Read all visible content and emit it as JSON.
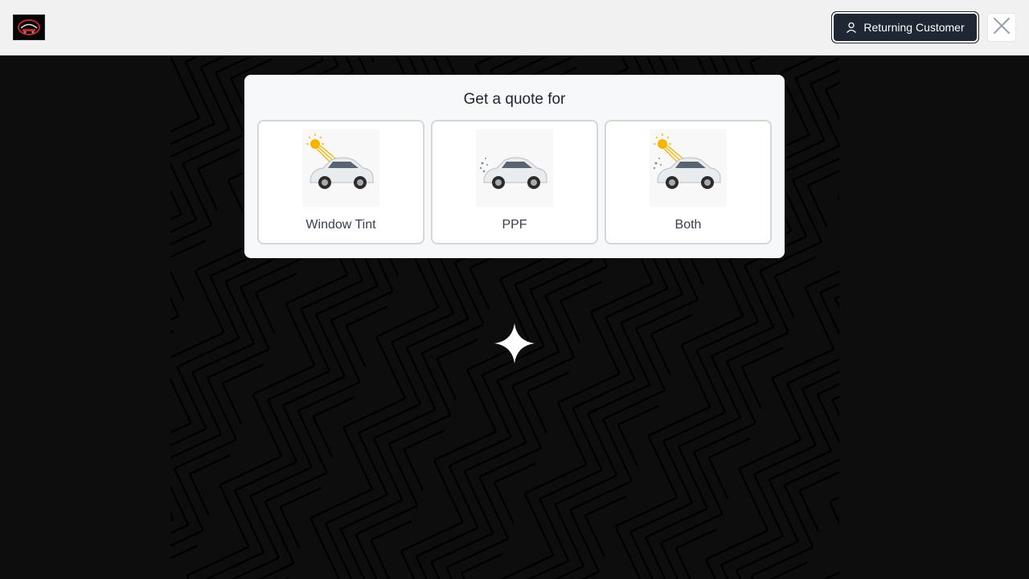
{
  "header": {
    "logo_icon": "company-logo-icon",
    "returning_customer_label": "Returning Customer",
    "returning_customer_icon": "user-icon",
    "close_icon": "close-icon"
  },
  "modal": {
    "title": "Get a quote for",
    "options": [
      {
        "label": "Window Tint",
        "icon": "car-sun-icon"
      },
      {
        "label": "PPF",
        "icon": "car-debris-icon"
      },
      {
        "label": "Both",
        "icon": "car-sun-debris-icon"
      }
    ]
  },
  "decor": {
    "center_icon": "sparkle-icon"
  },
  "colors": {
    "topbar_bg": "#f1f1f1",
    "page_bg": "#0d0d0d",
    "button_bg": "#1f2735",
    "modal_bg": "#f7f8fa",
    "card_border": "#d4d6db"
  }
}
